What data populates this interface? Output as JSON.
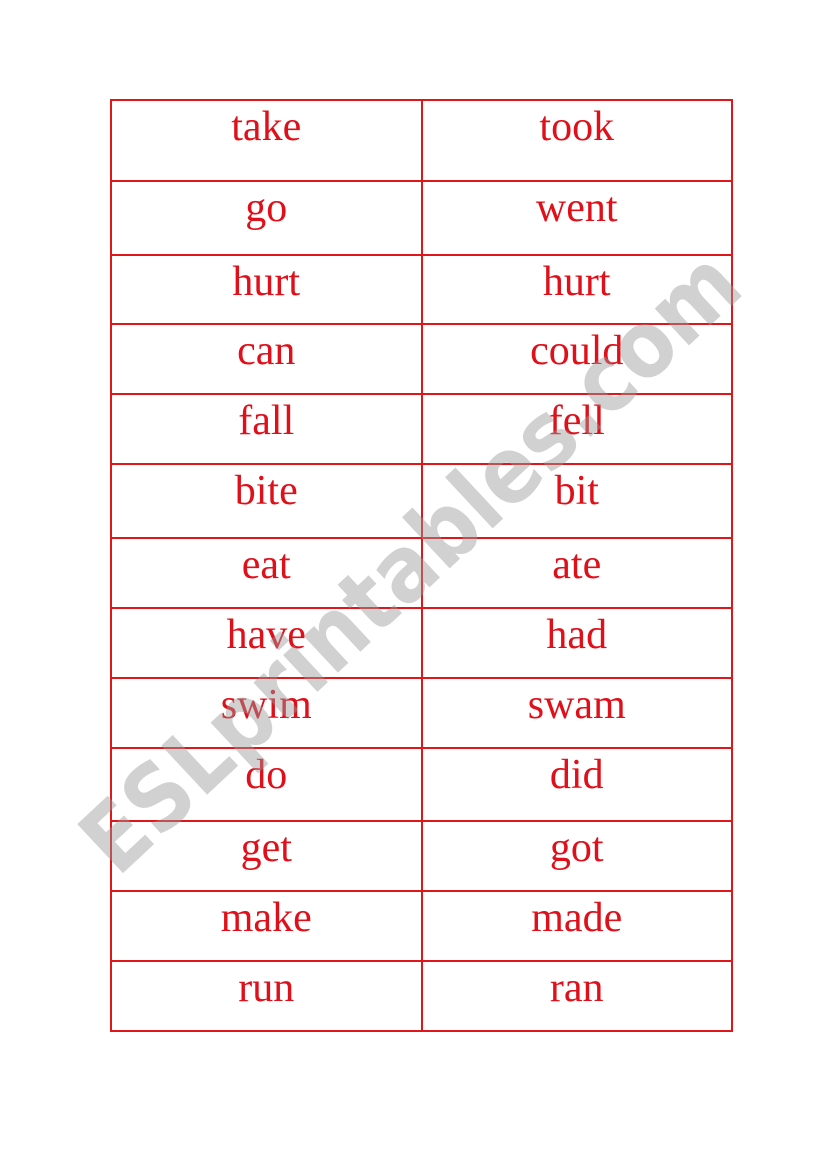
{
  "text_color": "#e0101a",
  "rows": [
    {
      "base": "take",
      "past": "took"
    },
    {
      "base": "go",
      "past": "went"
    },
    {
      "base": "hurt",
      "past": "hurt"
    },
    {
      "base": "can",
      "past": "could"
    },
    {
      "base": "fall",
      "past": "fell"
    },
    {
      "base": "bite",
      "past": "bit"
    },
    {
      "base": "eat",
      "past": "ate"
    },
    {
      "base": "have",
      "past": "had"
    },
    {
      "base": "swim",
      "past": "swam"
    },
    {
      "base": "do",
      "past": "did"
    },
    {
      "base": "get",
      "past": "got"
    },
    {
      "base": "make",
      "past": "made"
    },
    {
      "base": "run",
      "past": "ran"
    }
  ],
  "watermark": "ESLprintables.com"
}
